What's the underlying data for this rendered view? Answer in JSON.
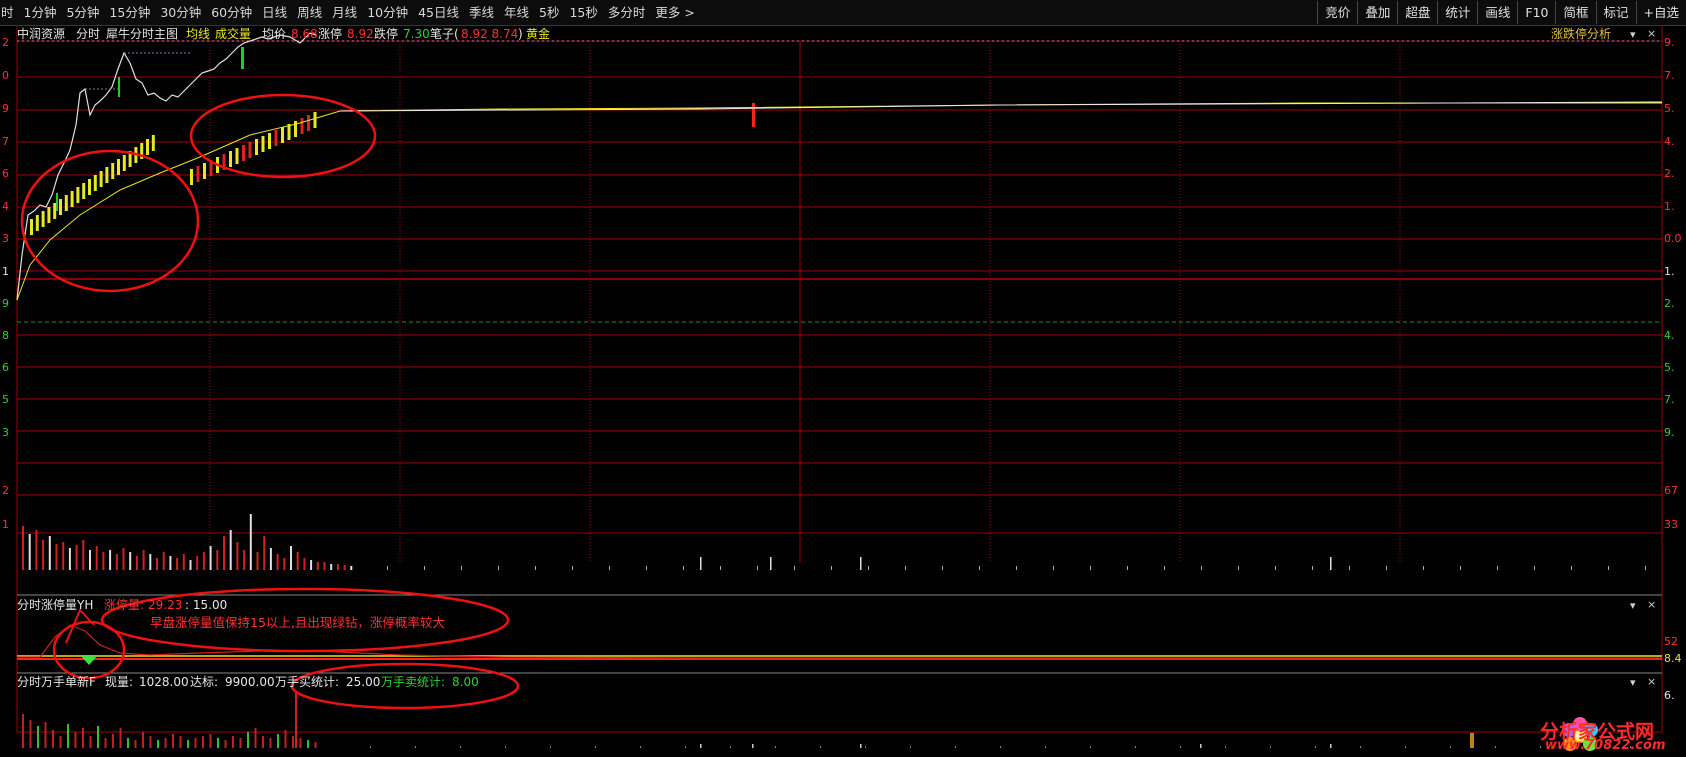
{
  "period_tabs": [
    "1分钟",
    "5分钟",
    "15分钟",
    "30分钟",
    "60分钟",
    "日线",
    "周线",
    "月线",
    "10分钟",
    "45日线",
    "季线",
    "年线",
    "5秒",
    "15秒",
    "多分时",
    "更多 >"
  ],
  "first_tab_glyph": "时",
  "right_tools": [
    "竞价",
    "叠加",
    "超盘",
    "统计",
    "画线",
    "F10",
    "简框",
    "标记",
    "+自选"
  ],
  "main_panel": {
    "stock_name": "中润资源",
    "mode": "分时",
    "indicator": "犀牛分时主图",
    "avg_line": "均线",
    "volume": "成交量",
    "avg_price_label": "均价",
    "avg_price": "8.68",
    "limit_up_label": "涨停",
    "limit_up": "8.92",
    "limit_down_label": "跌停",
    "limit_down": "7.30",
    "pen_label": "笔子(",
    "pen_values": "8.92 8.74",
    "pen_close": ")",
    "gold_label": "黄金",
    "analysis_button": "涨跌停分析"
  },
  "left_axis": [
    "2",
    "0",
    "9",
    "7",
    "6",
    "4",
    "3",
    "1",
    "9",
    "8",
    "6",
    "5",
    "3",
    "2",
    "1"
  ],
  "right_axis": [
    "9.",
    "7.",
    "5.",
    "4.",
    "2.",
    "1.",
    "0.0",
    "1.",
    "2.",
    "4.",
    "5.",
    "7.",
    "9.",
    "67",
    "33"
  ],
  "limit_panel": {
    "title": "分时涨停量YH",
    "limit_vol_label": "涨停量:",
    "limit_vol_value": "29.23",
    "threshold": ": 15.00",
    "annotation": "早盘涨停量值保持15以上,且出现绿钻，涨停概率较大",
    "right_value": "52",
    "right_value2": "8.4"
  },
  "big_order_panel": {
    "title": "分时万手单新F",
    "current_label": "现量:",
    "current_value": "1028.00",
    "target_label": "达标:",
    "target_value": "9900.00",
    "buy_label": "万手买统计:",
    "buy_value": "25.00",
    "sell_label": "万手卖统计:",
    "sell_value": "8.00",
    "right_value": "6."
  },
  "panel_controls": [
    "▾",
    "×"
  ],
  "watermark": {
    "name": "分析家公式网",
    "url": "www.70822.com"
  },
  "colors": {
    "grid_red": "#a00000",
    "zero_line": "#c00000",
    "price_line": "#e0e0e0",
    "avg_line": "#e8e820",
    "up_bar": "#e8e820",
    "limit_red": "#ff2020",
    "green_bar": "#20d020",
    "ellipse": "#ee1111"
  }
}
